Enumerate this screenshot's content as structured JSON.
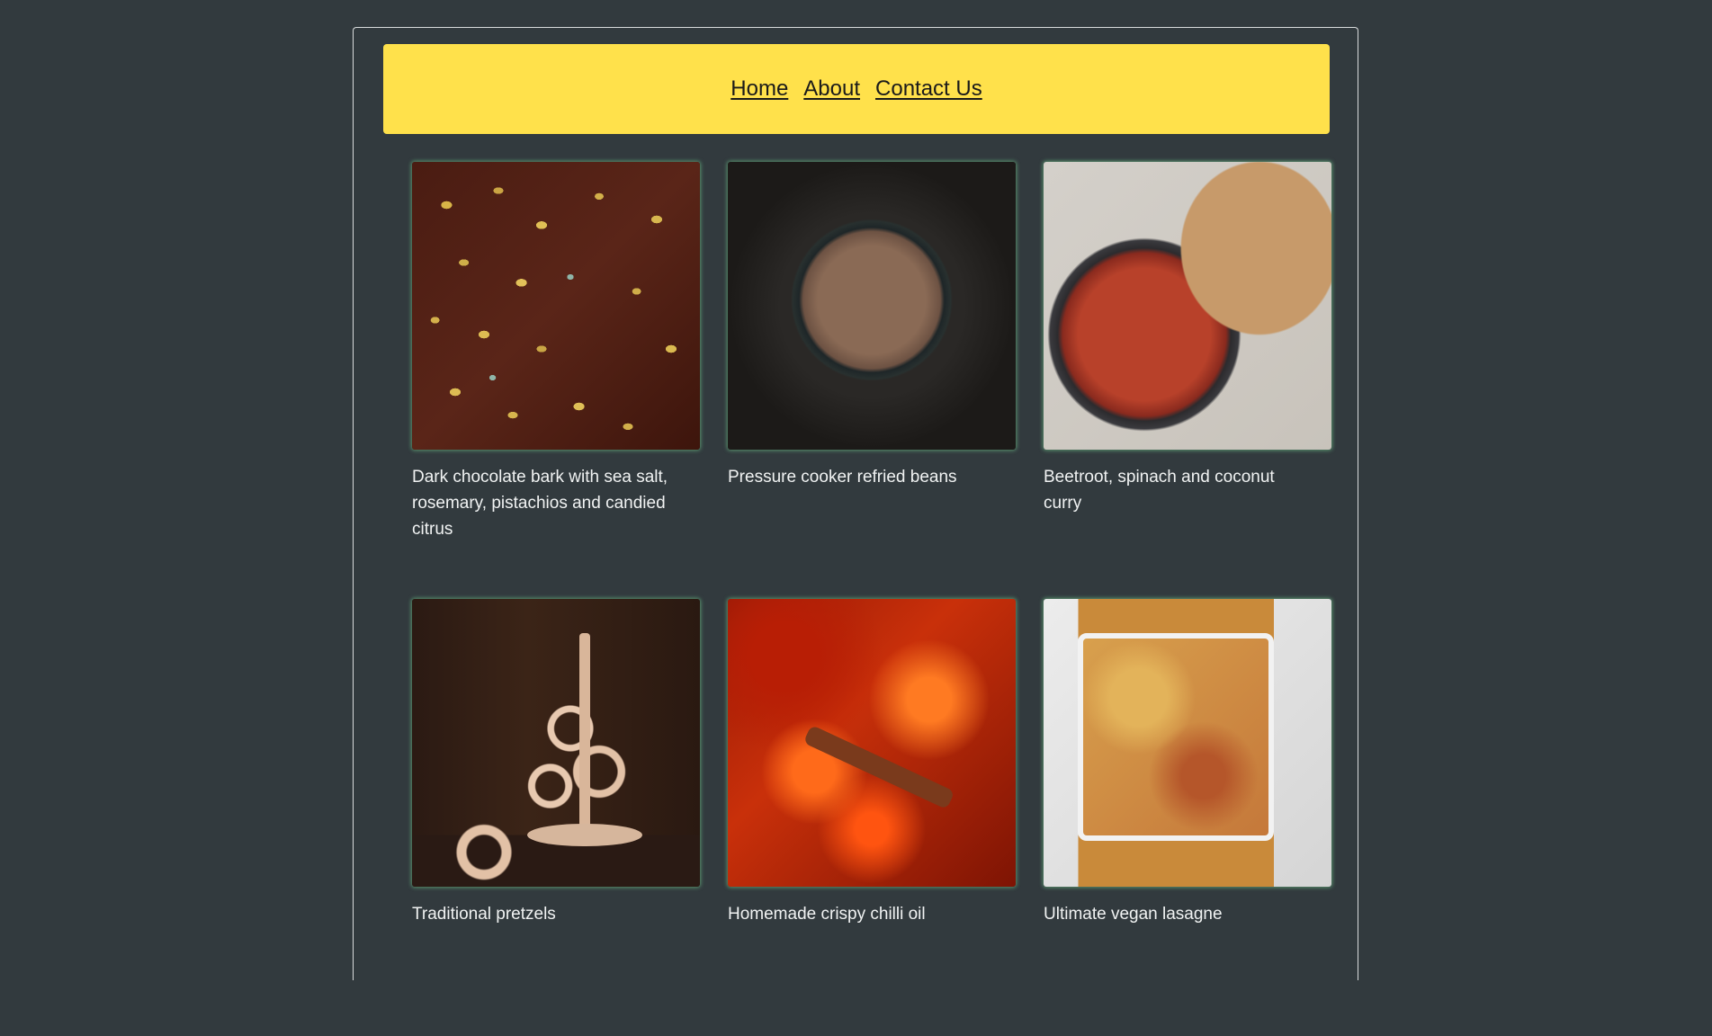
{
  "nav": {
    "home": "Home",
    "about": "About",
    "contact": "Contact Us"
  },
  "recipes": [
    {
      "title": "Dark chocolate bark with sea salt, rosemary, pistachios and candied citrus"
    },
    {
      "title": "Pressure cooker refried beans"
    },
    {
      "title": "Beetroot, spinach and coconut curry"
    },
    {
      "title": "Traditional pretzels"
    },
    {
      "title": "Homemade crispy chilli oil"
    },
    {
      "title": "Ultimate vegan lasagne"
    }
  ],
  "colors": {
    "background": "#323a3e",
    "navbar": "#ffe14b",
    "card_glow": "#78dc96",
    "caption_text": "#f1f3f3"
  }
}
